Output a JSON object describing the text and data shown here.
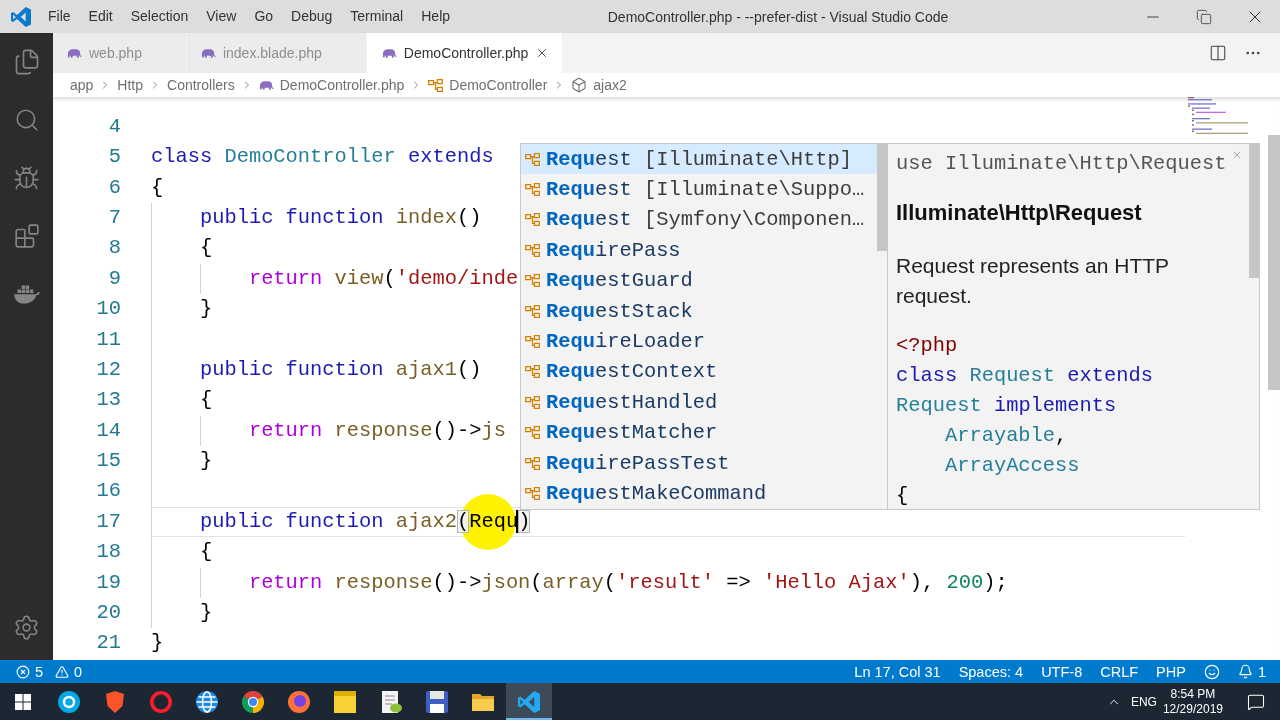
{
  "window": {
    "title": "DemoController.php - --prefer-dist - Visual Studio Code"
  },
  "menu": [
    "File",
    "Edit",
    "Selection",
    "View",
    "Go",
    "Debug",
    "Terminal",
    "Help"
  ],
  "tabs": [
    {
      "label": "web.php",
      "selected": false
    },
    {
      "label": "index.blade.php",
      "selected": false
    },
    {
      "label": "DemoController.php",
      "selected": true
    }
  ],
  "breadcrumbs": [
    {
      "kind": "folder",
      "label": "app"
    },
    {
      "kind": "folder",
      "label": "Http"
    },
    {
      "kind": "folder",
      "label": "Controllers"
    },
    {
      "kind": "file",
      "label": "DemoController.php"
    },
    {
      "kind": "class",
      "label": "DemoController"
    },
    {
      "kind": "method",
      "label": "ajax2"
    }
  ],
  "editor": {
    "lines": [
      {
        "number": "4",
        "current": false
      },
      {
        "number": "5",
        "current": false,
        "tokens": [
          {
            "kind": "keyword",
            "text": "class "
          },
          {
            "kind": "type",
            "text": "DemoController "
          },
          {
            "kind": "keyword",
            "text": "extends"
          }
        ]
      },
      {
        "number": "6",
        "current": false,
        "tokens": [
          {
            "kind": "plain",
            "text": "{"
          }
        ]
      },
      {
        "number": "7",
        "current": false,
        "tokens": [
          {
            "kind": "keyword",
            "text": "    public function "
          },
          {
            "kind": "function",
            "text": "index"
          },
          {
            "kind": "plain",
            "text": "()"
          }
        ]
      },
      {
        "number": "8",
        "current": false,
        "tokens": [
          {
            "kind": "plain",
            "text": "    {"
          }
        ]
      },
      {
        "number": "9",
        "current": false,
        "tokens": [
          {
            "kind": "control",
            "text": "        return "
          },
          {
            "kind": "function",
            "text": "view"
          },
          {
            "kind": "plain",
            "text": "("
          },
          {
            "kind": "string",
            "text": "'demo/inde"
          }
        ]
      },
      {
        "number": "10",
        "current": false,
        "tokens": [
          {
            "kind": "plain",
            "text": "    }"
          }
        ]
      },
      {
        "number": "11",
        "current": false
      },
      {
        "number": "12",
        "current": false,
        "tokens": [
          {
            "kind": "keyword",
            "text": "    public function "
          },
          {
            "kind": "function",
            "text": "ajax1"
          },
          {
            "kind": "plain",
            "text": "()"
          }
        ]
      },
      {
        "number": "13",
        "current": false,
        "tokens": [
          {
            "kind": "plain",
            "text": "    {"
          }
        ]
      },
      {
        "number": "14",
        "current": false,
        "tokens": [
          {
            "kind": "control",
            "text": "        return "
          },
          {
            "kind": "function",
            "text": "response"
          },
          {
            "kind": "plain",
            "text": "()->"
          },
          {
            "kind": "function",
            "text": "js"
          }
        ]
      },
      {
        "number": "15",
        "current": false,
        "tokens": [
          {
            "kind": "plain",
            "text": "    }"
          }
        ]
      },
      {
        "number": "16",
        "current": false
      },
      {
        "number": "17",
        "current": true,
        "tokens": [
          {
            "kind": "keyword",
            "text": "    public function "
          },
          {
            "kind": "function",
            "text": "ajax2"
          },
          {
            "kind": "bracket",
            "text": "("
          },
          {
            "kind": "typed",
            "text": "Requ"
          },
          {
            "kind": "bracket",
            "text": ")"
          }
        ]
      },
      {
        "number": "18",
        "current": false,
        "tokens": [
          {
            "kind": "plain",
            "text": "    {"
          }
        ]
      },
      {
        "number": "19",
        "current": false,
        "tokens": [
          {
            "kind": "control",
            "text": "        return "
          },
          {
            "kind": "function",
            "text": "response"
          },
          {
            "kind": "plain",
            "text": "()->"
          },
          {
            "kind": "function",
            "text": "json"
          },
          {
            "kind": "plain",
            "text": "("
          },
          {
            "kind": "function",
            "text": "array"
          },
          {
            "kind": "plain",
            "text": "("
          },
          {
            "kind": "string",
            "text": "'result'"
          },
          {
            "kind": "plain",
            "text": " => "
          },
          {
            "kind": "string",
            "text": "'Hello Ajax'"
          },
          {
            "kind": "plain",
            "text": "), "
          },
          {
            "kind": "number",
            "text": "200"
          },
          {
            "kind": "plain",
            "text": ");"
          }
        ]
      },
      {
        "number": "20",
        "current": false,
        "tokens": [
          {
            "kind": "plain",
            "text": "    }"
          }
        ]
      },
      {
        "number": "21",
        "current": false,
        "tokens": [
          {
            "kind": "plain",
            "text": "}"
          }
        ]
      }
    ]
  },
  "suggestions": {
    "items": [
      {
        "label": "**Requ**est",
        "detail": "[Illuminate\\Http]",
        "selected": true
      },
      {
        "label": "**Requ**est",
        "detail": "[Illuminate\\Suppo…",
        "selected": false
      },
      {
        "label": "**Requ**est",
        "detail": "[Symfony\\Componen…",
        "selected": false
      },
      {
        "label": "**Requ**irePass",
        "selected": false
      },
      {
        "label": "**Requ**estGuard",
        "selected": false
      },
      {
        "label": "**Requ**estStack",
        "selected": false
      },
      {
        "label": "**Requ**ireLoader",
        "selected": false
      },
      {
        "label": "**Requ**estContext",
        "selected": false
      },
      {
        "label": "**Requ**estHandled",
        "selected": false
      },
      {
        "label": "**Requ**estMatcher",
        "selected": false
      },
      {
        "label": "**Requ**irePassTest",
        "selected": false
      },
      {
        "label": "**Requ**estMakeCommand",
        "selected": false
      }
    ]
  },
  "details": {
    "signature": "use Illuminate\\Http\\Request",
    "title": "Illuminate\\Http\\Request",
    "description": "Request represents an HTTP request.",
    "code": [
      {
        "tokens": [
          {
            "kind": "tag",
            "text": "<?php"
          }
        ]
      },
      {
        "tokens": [
          {
            "kind": "keyword",
            "text": "class "
          },
          {
            "kind": "type",
            "text": "Request "
          },
          {
            "kind": "keyword",
            "text": "extends"
          }
        ]
      },
      {
        "tokens": [
          {
            "kind": "type",
            "text": "Request "
          },
          {
            "kind": "keyword",
            "text": "implements"
          }
        ]
      },
      {
        "tokens": [
          {
            "kind": "type",
            "text": "    Arrayable"
          },
          {
            "kind": "plain",
            "text": ","
          }
        ]
      },
      {
        "tokens": [
          {
            "kind": "type",
            "text": "    ArrayAccess"
          }
        ]
      },
      {
        "tokens": [
          {
            "kind": "plain",
            "text": "{"
          }
        ]
      }
    ]
  },
  "status_bar": {
    "errors": "5",
    "warnings": "0",
    "items": [
      "Ln 17, Col 31",
      "Spaces: 4",
      "UTF-8",
      "CRLF",
      "PHP"
    ],
    "notifications": "1"
  },
  "taskbar": {
    "apps": [
      {
        "selected": false
      },
      {
        "selected": false
      },
      {
        "selected": false
      },
      {
        "selected": false
      },
      {
        "selected": false
      },
      {
        "selected": false
      },
      {
        "selected": false
      },
      {
        "selected": false
      },
      {
        "selected": false
      },
      {
        "selected": false
      },
      {
        "selected": true
      }
    ],
    "language": "ENG",
    "time": "8:54 PM",
    "date": "12/29/2019"
  }
}
